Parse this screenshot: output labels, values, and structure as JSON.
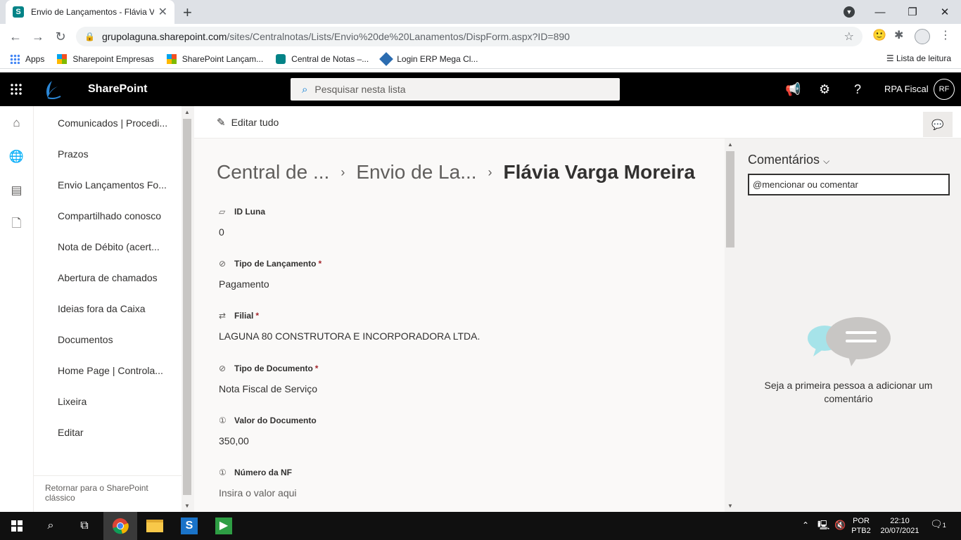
{
  "browser": {
    "tab_title": "Envio de Lançamentos - Flávia Va",
    "tab_favicon": "S",
    "url_host": "grupolaguna.sharepoint.com",
    "url_path": "/sites/Centralnotas/Lists/Envio%20de%20Lanamentos/DispForm.aspx?ID=890",
    "bookmarks": [
      {
        "label": "Apps",
        "icon": "apps-grid-icon"
      },
      {
        "label": "Sharepoint Empresas",
        "icon": "microsoft-logo-icon"
      },
      {
        "label": "SharePoint Lançam...",
        "icon": "microsoft-logo-icon"
      },
      {
        "label": "Central de Notas –...",
        "icon": "sharepoint-icon"
      },
      {
        "label": "Login ERP Mega Cl...",
        "icon": "mega-logo-icon"
      }
    ],
    "reading_list": "Lista de leitura"
  },
  "suite": {
    "app_name": "SharePoint",
    "search_placeholder": "Pesquisar nesta lista",
    "user_name": "RPA Fiscal",
    "user_initials": "RF"
  },
  "leftnav": {
    "items": [
      "Comunicados | Procedi...",
      "Prazos",
      "Envio Lançamentos Fo...",
      "Compartilhado conosco",
      "Nota de Débito (acert...",
      "Abertura de chamados",
      "Ideias fora da Caixa",
      "Documentos",
      "Home Page | Controla...",
      "Lixeira",
      "Editar"
    ],
    "footer": "Retornar para o SharePoint clássico"
  },
  "commandbar": {
    "edit_all": "Editar tudo"
  },
  "breadcrumb": {
    "crumb1": "Central de ...",
    "crumb2": "Envio de La...",
    "current": "Flávia Varga Moreira"
  },
  "fields": [
    {
      "label": "ID Luna",
      "required": "",
      "value": "0",
      "icon": "id-icon"
    },
    {
      "label": "Tipo de Lançamento",
      "required": "*",
      "value": "Pagamento",
      "icon": "choice-check-icon"
    },
    {
      "label": "Filial",
      "required": "*",
      "value": "LAGUNA 80 CONSTRUTORA E INCORPORADORA LTDA.",
      "icon": "lookup-arrows-icon"
    },
    {
      "label": "Tipo de Documento",
      "required": "*",
      "value": "Nota Fiscal de Serviço",
      "icon": "choice-check-icon"
    },
    {
      "label": "Valor do Documento",
      "required": "",
      "value": "350,00",
      "icon": "number-icon"
    },
    {
      "label": "Número da NF",
      "required": "",
      "value": "Insira o valor aqui",
      "icon": "number-icon"
    }
  ],
  "comments": {
    "title": "Comentários",
    "input_placeholder": "@mencionar ou comentar",
    "empty_text": "Seja a primeira pessoa a adicionar um comentário"
  },
  "taskbar": {
    "lang_top": "POR",
    "lang_bottom": "PTB2",
    "time": "22:10",
    "date": "20/07/2021",
    "notifications": "1"
  }
}
